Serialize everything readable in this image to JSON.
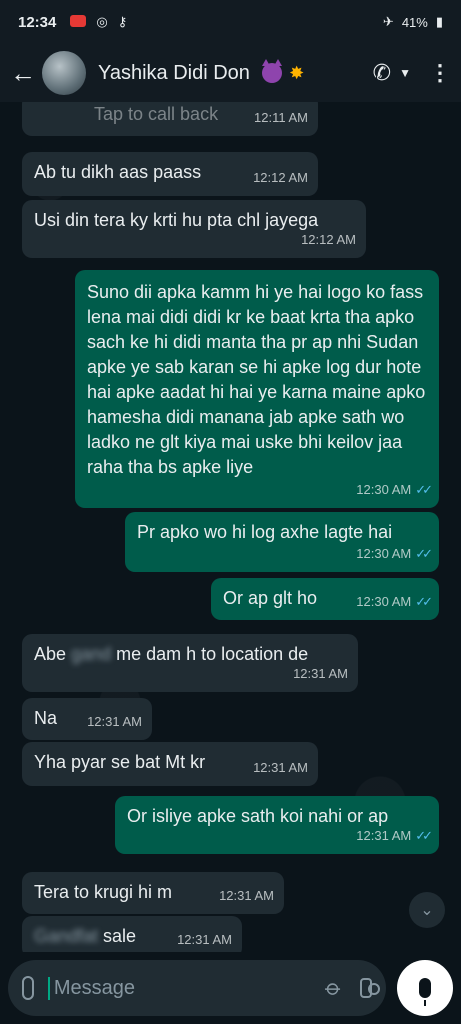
{
  "status_bar": {
    "time": "12:34",
    "battery": "41%",
    "icons": [
      "screen-record-icon",
      "instagram-icon",
      "key-icon",
      "airplane-icon",
      "battery-icon"
    ]
  },
  "header": {
    "contact_name": "Yashika Didi Don",
    "icons": [
      "back-arrow-icon",
      "call-icon",
      "dropdown-icon",
      "more-options-icon"
    ]
  },
  "messages": [
    {
      "dir": "in",
      "text": "Tap to call back",
      "time": "12:11 AM"
    },
    {
      "dir": "in",
      "text": "Ab tu dikh aas paass",
      "time": "12:12 AM"
    },
    {
      "dir": "in",
      "text": "Usi din tera ky krti hu pta chl jayega",
      "time": "12:12 AM"
    },
    {
      "dir": "out",
      "text": "Suno dii apka kamm hi ye hai logo ko fass lena mai didi didi kr ke baat krta tha apko sach ke hi didi manta tha pr ap nhi Sudan apke ye sab karan se hi apke log dur hote hai apke aadat hi hai ye karna maine apko hamesha didi manana jab apke sath wo ladko ne glt kiya mai uske bhi keilov jaa raha tha bs apke liye",
      "time": "12:30 AM"
    },
    {
      "dir": "out",
      "text": "Pr apko wo hi log axhe lagte hai",
      "time": "12:30 AM"
    },
    {
      "dir": "out",
      "text": "Or ap glt ho",
      "time": "12:30 AM"
    },
    {
      "dir": "in",
      "text_before": "Abe ",
      "text_blur": "gand",
      "text_after": " me dam h to location de",
      "time": "12:31 AM"
    },
    {
      "dir": "in",
      "text": "Na",
      "time": "12:31 AM"
    },
    {
      "dir": "in",
      "text": "Yha pyar se bat Mt kr",
      "time": "12:31 AM"
    },
    {
      "dir": "out",
      "text": "Or isliye apke sath koi nahi or ap",
      "time": "12:31 AM"
    },
    {
      "dir": "in",
      "text": "Tera to krugi hi m",
      "time": "12:31 AM"
    },
    {
      "dir": "in",
      "text_blur": "Gandfat",
      "text_after": " sale",
      "time": "12:31 AM"
    }
  ],
  "composer": {
    "placeholder": "Message"
  },
  "colors": {
    "background": "#0b141a",
    "incoming_bubble": "#202c33",
    "outgoing_bubble": "#005c4b",
    "read_ticks": "#53bdeb"
  }
}
